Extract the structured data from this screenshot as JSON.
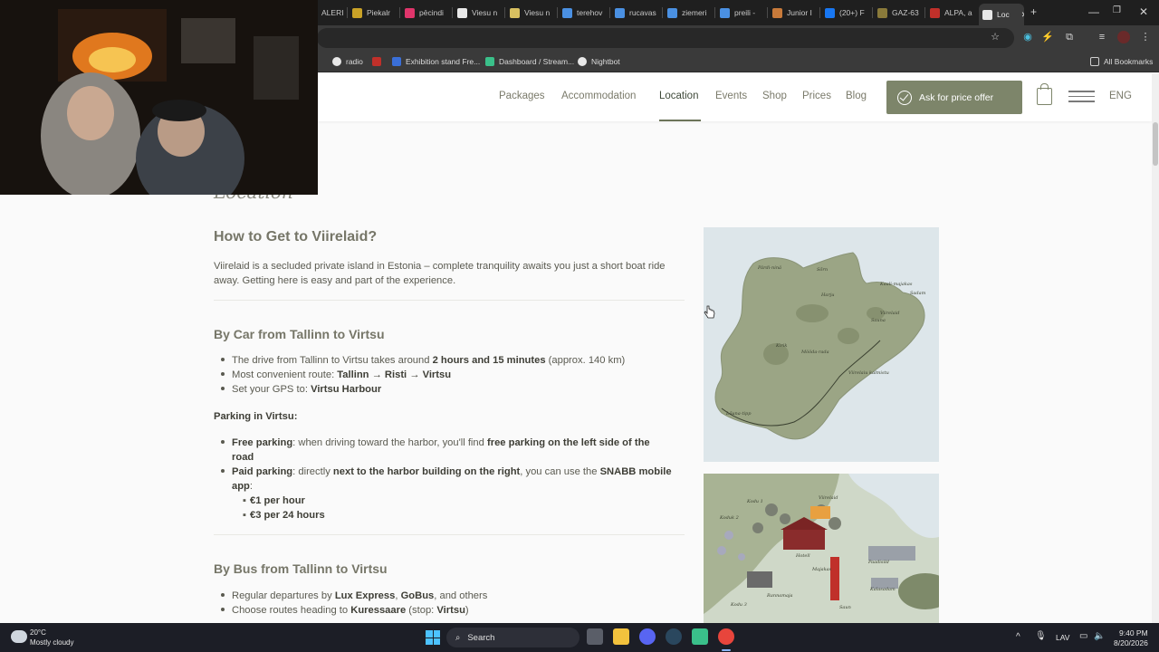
{
  "browser": {
    "tabs": [
      {
        "label": "ALERI",
        "color": "#8a3a3a"
      },
      {
        "label": "Piekalr",
        "color": "#c9a227"
      },
      {
        "label": "pēcindi",
        "color": "#e0356b"
      },
      {
        "label": "Viesu n",
        "color": "#e8e8e8"
      },
      {
        "label": "Viesu n",
        "color": "#d8c060"
      },
      {
        "label": "terehov",
        "color": "#4a90e2"
      },
      {
        "label": "rucavas",
        "color": "#4a90e2"
      },
      {
        "label": "ziemeri",
        "color": "#4a90e2"
      },
      {
        "label": "preili -",
        "color": "#4a90e2"
      },
      {
        "label": "Junior I",
        "color": "#c87a3a"
      },
      {
        "label": "(20+) F",
        "color": "#1877f2"
      },
      {
        "label": "GAZ-63",
        "color": "#8a7a3a"
      },
      {
        "label": "ALPA, a",
        "color": "#c0302a"
      },
      {
        "label": "Loc",
        "color": "#e8e8e8"
      }
    ],
    "new_tab": "+",
    "bookmarks": [
      {
        "label": "radio",
        "color": "#e8e8e8"
      },
      {
        "label": "",
        "color": "#c0302a"
      },
      {
        "label": "Exhibition stand Fre...",
        "color": "#3a6fd8"
      },
      {
        "label": "Dashboard / Stream...",
        "color": "#3ac08a"
      },
      {
        "label": "Nightbot",
        "color": "#e8e8e8"
      }
    ],
    "all_bookmarks": "All Bookmarks"
  },
  "site": {
    "nav": [
      "Packages",
      "Accommodation",
      "Location",
      "Events",
      "Shop",
      "Prices",
      "Blog"
    ],
    "active_nav": "Location",
    "cta_label": "Ask for price offer",
    "lang": "ENG",
    "accent": "#7d856a"
  },
  "page": {
    "heading": "Location",
    "h2": "How to Get to Viirelaid?",
    "intro": "Viirelaid is a secluded private island in Estonia – complete tranquility awaits you just a short boat ride away. Getting here is easy and part of the experience.",
    "car": {
      "title": "By Car from Tallinn to Virtsu",
      "items": [
        {
          "pre": "The drive from Tallinn to Virtsu takes around ",
          "bold": "2 hours and 15 minutes",
          "post": " (approx. 140 km)"
        },
        {
          "pre": "Most convenient route: ",
          "bold": "Tallinn → Risti → Virtsu",
          "post": ""
        },
        {
          "pre": "Set your GPS to: ",
          "bold": "Virtsu Harbour",
          "post": ""
        }
      ],
      "parking_title": "Parking in Virtsu:",
      "free_bold": "Free parking",
      "free_mid": ": when driving toward the harbor, you'll find ",
      "free_bold2": "free parking on the left side of the",
      "free_line2": "road",
      "paid_bold": "Paid parking",
      "paid_mid": ": directly ",
      "paid_bold2": "next to the harbor building on the right",
      "paid_mid2": ", you can use the ",
      "paid_bold3": "SNABB mobile",
      "paid_line2_bold": "app",
      "paid_line2_rest": ":",
      "prices": [
        "€1 per hour",
        "€3 per 24 hours"
      ]
    },
    "bus": {
      "title": "By Bus from Tallinn to Virtsu",
      "items": [
        {
          "pre": "Regular departures by ",
          "b1": "Lux Express",
          "mid": ", ",
          "b2": "GoBus",
          "post": ", and others"
        },
        {
          "pre": "Choose routes heading to ",
          "b1": "Kuressaare",
          "mid": " (stop: ",
          "b2": "Virtsu",
          "post": ")"
        }
      ]
    },
    "map1_labels": [
      "Pärdi-ninä",
      "Sõrn",
      "Kaali-majakas",
      "Sadam",
      "Viirelaid",
      "Sauna",
      "Kirik",
      "Mööda-rada",
      "Lõuna-tipp",
      "Viirelaiu kalmistu",
      "Harju"
    ],
    "map2_labels": [
      "Kodu 1",
      "Viirelaid",
      "Koduk 2",
      "Hotell",
      "Majakas",
      "Saun",
      "Paadisild",
      "Kodu 3",
      "Kalasadam",
      "Rannamaja"
    ]
  },
  "taskbar": {
    "weather_temp": "20°C",
    "weather_desc": "Mostly cloudy",
    "search": "Search",
    "lang": "LAV",
    "time": "9:40 PM",
    "date": "8/20/2026"
  }
}
